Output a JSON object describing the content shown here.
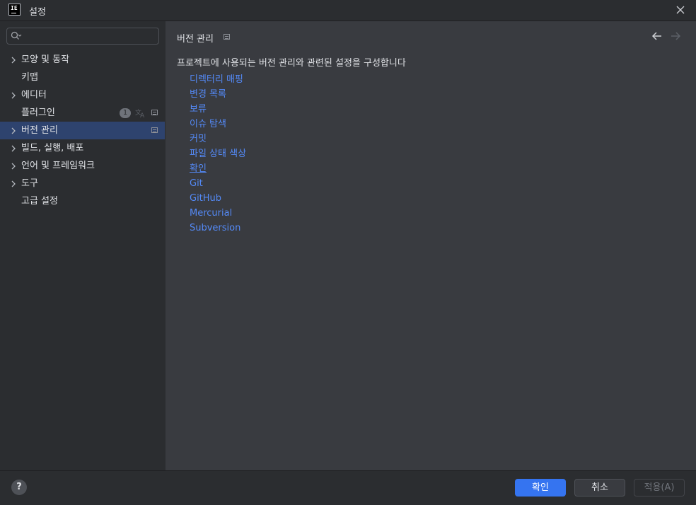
{
  "window": {
    "title": "설정",
    "app_icon_text": "IE"
  },
  "search": {
    "placeholder": "",
    "value": ""
  },
  "sidebar": {
    "items": [
      {
        "label": "모양 및 동작",
        "expandable": true
      },
      {
        "label": "키맵",
        "expandable": false
      },
      {
        "label": "에디터",
        "expandable": true
      },
      {
        "label": "플러그인",
        "expandable": false,
        "badge": "1"
      },
      {
        "label": "버전 관리",
        "expandable": true,
        "selected": true
      },
      {
        "label": "빌드, 실행, 배포",
        "expandable": true
      },
      {
        "label": "언어 및 프레임워크",
        "expandable": true
      },
      {
        "label": "도구",
        "expandable": true
      },
      {
        "label": "고급 설정",
        "expandable": false
      }
    ]
  },
  "main": {
    "title": "버전 관리",
    "description": "프로젝트에 사용되는 버전 관리와 관련된 설정을 구성합니다",
    "links": [
      "디렉터리 매핑",
      "변경 목록",
      "보류",
      "이슈 탐색",
      "커밋",
      "파일 상태 색상",
      "확인",
      "Git",
      "GitHub",
      "Mercurial",
      "Subversion"
    ]
  },
  "footer": {
    "help": "?",
    "ok_label": "확인",
    "cancel_label": "취소",
    "apply_label": "적용(A)"
  },
  "colors": {
    "accent": "#3574f0",
    "link": "#548af7",
    "selection": "#2e436e",
    "sidebar_bg": "#2b2d30",
    "content_bg": "#393b40"
  }
}
